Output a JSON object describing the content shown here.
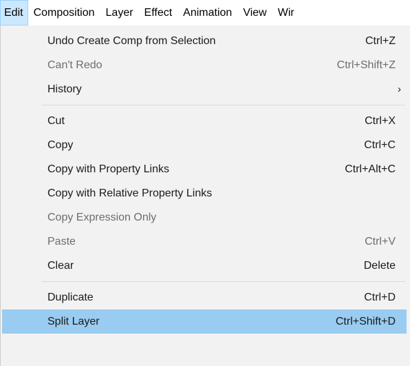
{
  "menubar": {
    "items": [
      "Edit",
      "Composition",
      "Layer",
      "Effect",
      "Animation",
      "View",
      "Wir"
    ]
  },
  "menu": {
    "groups": [
      [
        {
          "label": "Undo Create Comp from Selection",
          "shortcut": "Ctrl+Z",
          "disabled": false
        },
        {
          "label": "Can't Redo",
          "shortcut": "Ctrl+Shift+Z",
          "disabled": true
        },
        {
          "label": "History",
          "shortcut": "",
          "submenu": true,
          "disabled": false
        }
      ],
      [
        {
          "label": "Cut",
          "shortcut": "Ctrl+X",
          "disabled": false
        },
        {
          "label": "Copy",
          "shortcut": "Ctrl+C",
          "disabled": false
        },
        {
          "label": "Copy with Property Links",
          "shortcut": "Ctrl+Alt+C",
          "disabled": false
        },
        {
          "label": "Copy with Relative Property Links",
          "shortcut": "",
          "disabled": false
        },
        {
          "label": "Copy Expression Only",
          "shortcut": "",
          "disabled": true
        },
        {
          "label": "Paste",
          "shortcut": "Ctrl+V",
          "disabled": true
        },
        {
          "label": "Clear",
          "shortcut": "Delete",
          "disabled": false
        }
      ],
      [
        {
          "label": "Duplicate",
          "shortcut": "Ctrl+D",
          "disabled": false
        },
        {
          "label": "Split Layer",
          "shortcut": "Ctrl+Shift+D",
          "disabled": false,
          "highlighted": true
        }
      ]
    ],
    "submenu_glyph": "›"
  },
  "colors": {
    "active_menubar_bg": "#cce8ff",
    "highlight_row_bg": "#99ccf0",
    "disabled_text": "#6d6d6d",
    "dropdown_bg": "#f2f2f2"
  }
}
